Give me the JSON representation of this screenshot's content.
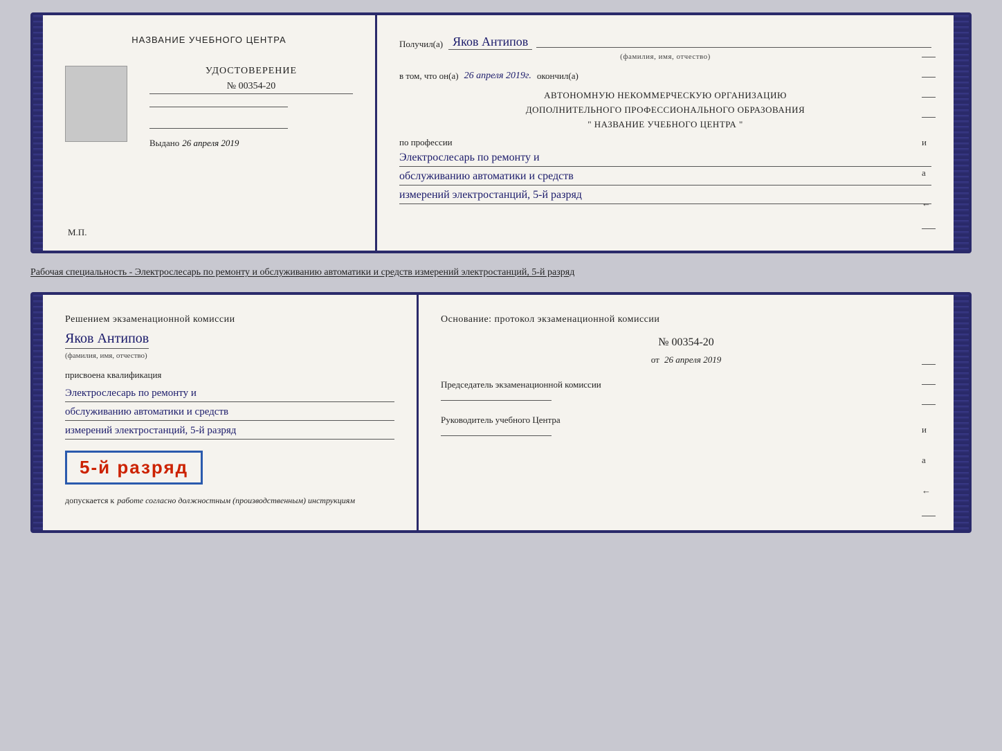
{
  "top_book": {
    "left": {
      "title": "НАЗВАНИЕ УЧЕБНОГО ЦЕНТРА",
      "udostoverenie_label": "УДОСТОВЕРЕНИЕ",
      "number": "№ 00354-20",
      "vydano_label": "Выдано",
      "vydano_date": "26 апреля 2019",
      "mp_label": "М.П."
    },
    "right": {
      "poluchil_label": "Получил(а)",
      "fio_handwritten": "Яков Антипов",
      "fio_sub": "(фамилия, имя, отчество)",
      "vtom_label": "в том, что он(а)",
      "vtom_date": "26 апреля 2019г.",
      "okönchil_label": "окончил(а)",
      "org_line1": "АВТОНОМНУЮ НЕКОММЕРЧЕСКУЮ ОРГАНИЗАЦИЮ",
      "org_line2": "ДОПОЛНИТЕЛЬНОГО ПРОФЕССИОНАЛЬНОГО ОБРАЗОВАНИЯ",
      "org_line3": "\"   НАЗВАНИЕ УЧЕБНОГО ЦЕНТРА   \"",
      "po_professii_label": "по профессии",
      "profession_line1": "Электрослесарь по ремонту и",
      "profession_line2": "обслуживанию автоматики и средств",
      "profession_line3": "измерений электростанций, 5-й разряд"
    }
  },
  "specialty_text": "Рабочая специальность - Электрослесарь по ремонту и обслуживанию автоматики и средств измерений электростанций, 5-й разряд",
  "bottom_book": {
    "left": {
      "komissia_title": "Решением экзаменационной комиссии",
      "fio_handwritten": "Яков Антипов",
      "fio_sub": "(фамилия, имя, отчество)",
      "prisvoena_label": "присвоена квалификация",
      "q_line1": "Электрослесарь по ремонту и",
      "q_line2": "обслуживанию автоматики и средств",
      "q_line3": "измерений электростанций, 5-й разряд",
      "razryad_badge": "5-й разряд",
      "dopuskaetsya_label": "допускается к",
      "dopuskaetsya_italic": "работе согласно должностным (производственным) инструкциям"
    },
    "right": {
      "osnov_label": "Основание: протокол экзаменационной комиссии",
      "number": "№  00354-20",
      "ot_label": "от",
      "ot_date": "26 апреля 2019",
      "predsedatel_title": "Председатель экзаменационной комиссии",
      "rukovoditel_title": "Руководитель учебного Центра"
    }
  }
}
